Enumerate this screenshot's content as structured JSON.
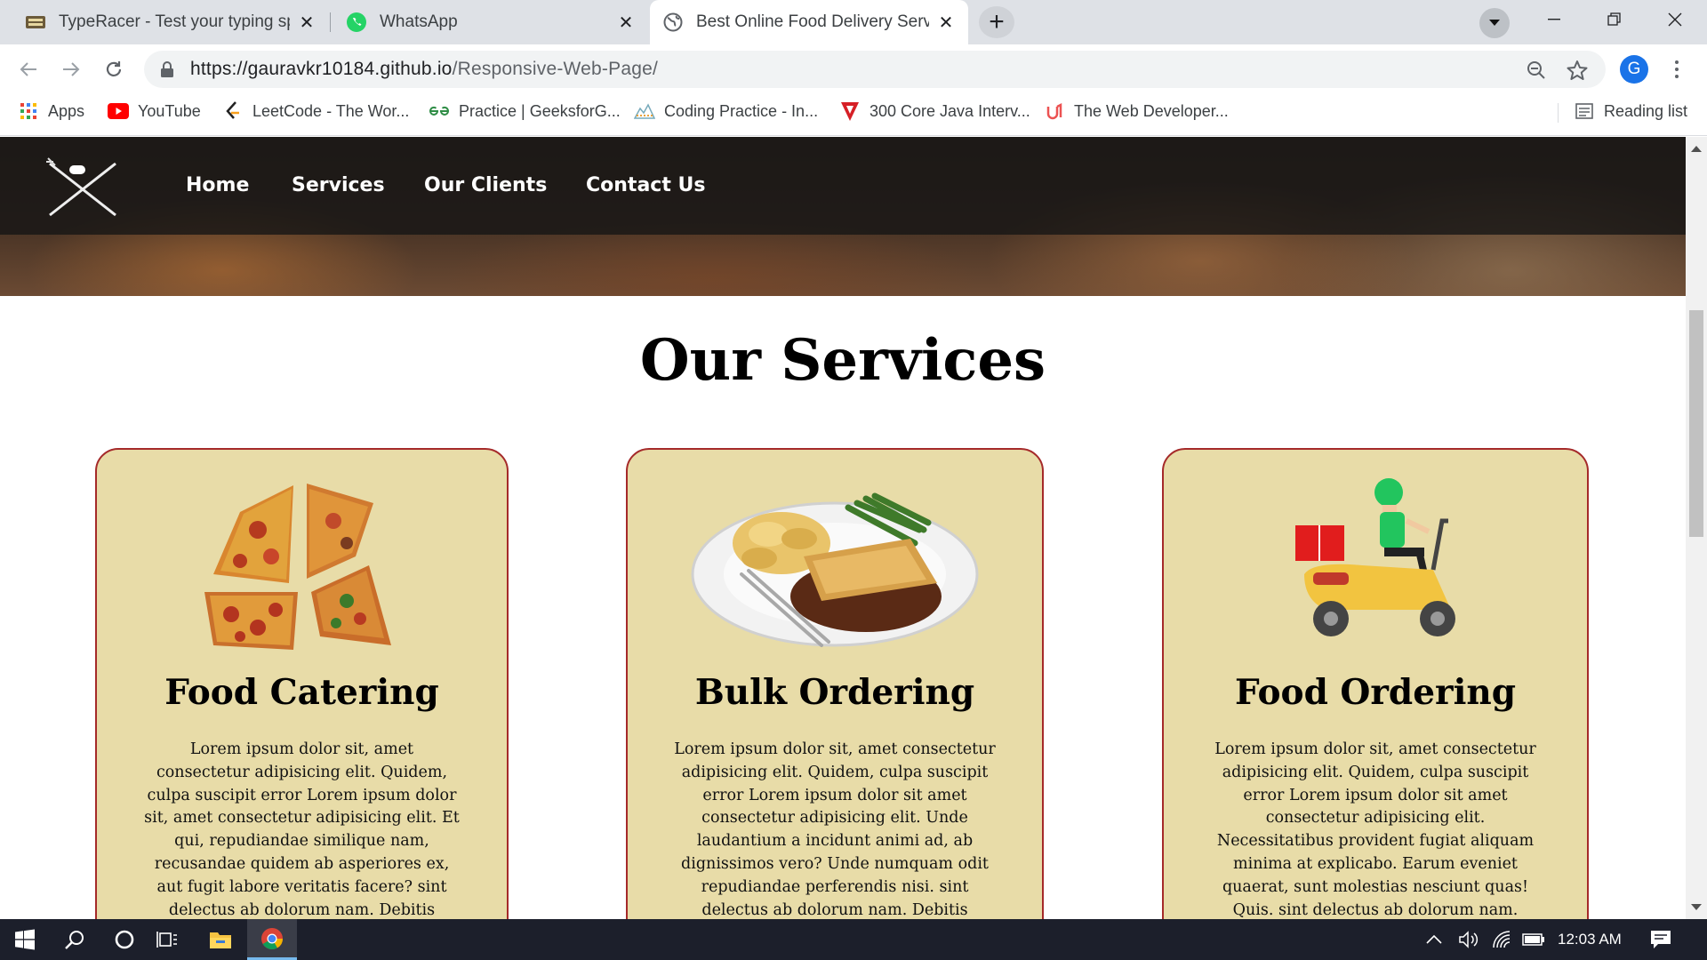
{
  "browser": {
    "tabs": [
      {
        "title": "TypeRacer - Test your typing spee",
        "icon": "typeracer-icon",
        "active": false
      },
      {
        "title": "WhatsApp",
        "icon": "whatsapp-icon",
        "active": false
      },
      {
        "title": "Best Online Food Delivery Service",
        "icon": "globe-icon",
        "active": true
      }
    ],
    "new_tab_label": "+",
    "close_label": "✕",
    "address": {
      "host": "https://gauravkr10184.github.io",
      "path": "/Responsive-Web-Page/"
    },
    "profile_initial": "G",
    "bookmarks": [
      {
        "label": "Apps",
        "icon": "apps-grid-icon"
      },
      {
        "label": "YouTube",
        "icon": "youtube-icon"
      },
      {
        "label": "LeetCode - The Wor...",
        "icon": "leetcode-icon"
      },
      {
        "label": "Practice | GeeksforG...",
        "icon": "geeksforgeeks-icon"
      },
      {
        "label": "Coding Practice - In...",
        "icon": "codingninjas-icon"
      },
      {
        "label": "300 Core Java Interv...",
        "icon": "javatpoint-icon"
      },
      {
        "label": "The Web Developer...",
        "icon": "udemy-icon"
      }
    ],
    "reading_list": "Reading list"
  },
  "site": {
    "nav": [
      "Home",
      "Services",
      "Our Clients",
      "Contact Us"
    ],
    "section_title": "Our Services",
    "cards": [
      {
        "title": "Food Catering",
        "image": "pizza-slices-image",
        "text": "Lorem ipsum dolor sit, amet consectetur adipisicing elit. Quidem, culpa suscipit error Lorem ipsum dolor sit, amet consectetur adipisicing elit. Et qui, repudiandae similique nam, recusandae quidem ab asperiores ex, aut fugit labore veritatis facere? sint delectus ab dolorum nam. Debitis facere, incidunt voluptates eos, mollitia"
      },
      {
        "title": "Bulk Ordering",
        "image": "plated-meal-image",
        "text": "Lorem ipsum dolor sit, amet consectetur adipisicing elit. Quidem, culpa suscipit error Lorem ipsum dolor sit amet consectetur adipisicing elit. Unde laudantium a incidunt animi ad, ab dignissimos vero? Unde numquam odit repudiandae perferendis nisi. sint delectus ab dolorum nam. Debitis facere, incidunt voluptates eos, mollitia"
      },
      {
        "title": "Food Ordering",
        "image": "delivery-scooter-image",
        "text": "Lorem ipsum dolor sit, amet consectetur adipisicing elit. Quidem, culpa suscipit error Lorem ipsum dolor sit amet consectetur adipisicing elit. Necessitatibus provident fugiat aliquam minima at explicabo. Earum eveniet quaerat, sunt molestias nesciunt quas! Quis. sint delectus ab dolorum nam. Debitis facere, incidunt voluptates eos, mollitia"
      }
    ]
  },
  "taskbar": {
    "time": "12:03 AM"
  },
  "colors": {
    "card_bg": "#e8dca8",
    "card_border": "#a52a2a",
    "nav_text": "#ffffff",
    "taskbar_bg": "#1c1f2b"
  }
}
